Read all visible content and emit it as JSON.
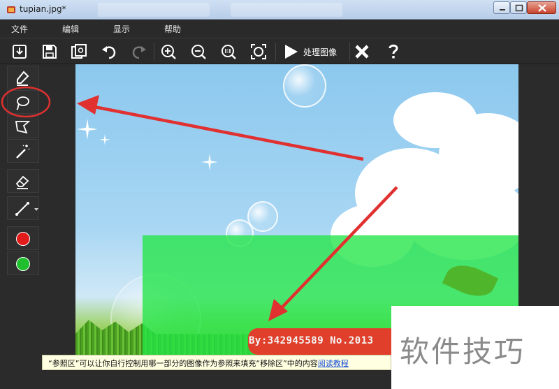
{
  "window": {
    "title": "tupian.jpg*"
  },
  "menu": {
    "items": [
      "文件",
      "编辑",
      "显示",
      "帮助"
    ]
  },
  "toolbar": {
    "process_label": "处理图像"
  },
  "canvas": {
    "watermark_text": "By:342945589  No.2013"
  },
  "hint": {
    "text": "“参照区”可以让你自行控制用哪一部分的图像作为参照来填充“移除区”中的内容",
    "link": "阅读教程"
  },
  "site_watermark": "软件技巧",
  "colors": {
    "red_color": "#e21b1b",
    "green_color": "#1fbf2e",
    "annotation_red": "#e03030"
  },
  "icons": {
    "toolbar": [
      "open-icon",
      "save-icon",
      "save-copy-icon",
      "undo-icon",
      "redo-icon",
      "zoom-in-icon",
      "zoom-out-icon",
      "zoom-1-1-icon",
      "zoom-fit-icon",
      "play-icon",
      "cancel-x-icon",
      "help-icon"
    ],
    "side": [
      "marker-icon",
      "lasso-icon",
      "polygon-lasso-icon",
      "magic-wand-icon",
      "eraser-icon",
      "line-icon"
    ]
  }
}
